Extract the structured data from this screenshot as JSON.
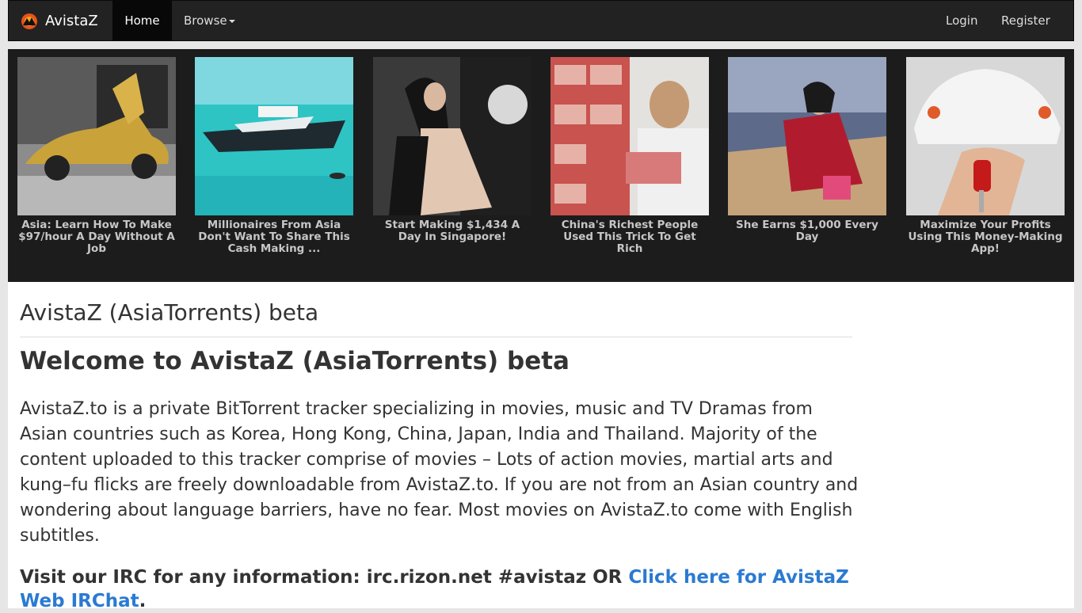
{
  "nav": {
    "brand": "AvistaZ",
    "home": "Home",
    "browse": "Browse",
    "login": "Login",
    "register": "Register"
  },
  "ads": [
    {
      "title": "Asia: Learn How To Make $97/hour A Day Without A Job",
      "image": "gold-sports-car"
    },
    {
      "title": "Millionaires From Asia Don't Want To Share This Cash Making ...",
      "image": "yacht-on-turquoise-sea"
    },
    {
      "title": "Start Making $1,434 A Day In Singapore!",
      "image": "woman-in-car"
    },
    {
      "title": "China's Richest People Used This Trick To Get Rich",
      "image": "man-with-cash-stacks"
    },
    {
      "title": "She Earns $1,000 Every Day",
      "image": "woman-in-convertible"
    },
    {
      "title": "Maximize Your Profits Using This Money-Making App!",
      "image": "hand-holding-car-key"
    }
  ],
  "main": {
    "page_title": "AvistaZ (AsiaTorrents) beta",
    "welcome": "Welcome to AvistaZ (AsiaTorrents) beta",
    "intro": "AvistaZ.to is a private BitTorrent tracker specializing in movies, music and TV Dramas from Asian countries such as Korea, Hong Kong, China, Japan, India and Thailand. Majority of the content uploaded to this tracker comprise of movies – Lots of action movies, martial arts and kung–fu flicks are freely downloadable from AvistaZ.to. If you are not from an Asian country and wondering about language barriers, have no fear. Most movies on AvistaZ.to come with English subtitles.",
    "irc_text": "Visit our IRC for any information: irc.rizon.net #avistaz OR ",
    "irc_link": "Click here for AvistaZ Web IRChat",
    "irc_end": "."
  },
  "colors": {
    "navbar": "#222222",
    "ad_strip": "#1c1c1c",
    "link": "#2a7ad2"
  }
}
